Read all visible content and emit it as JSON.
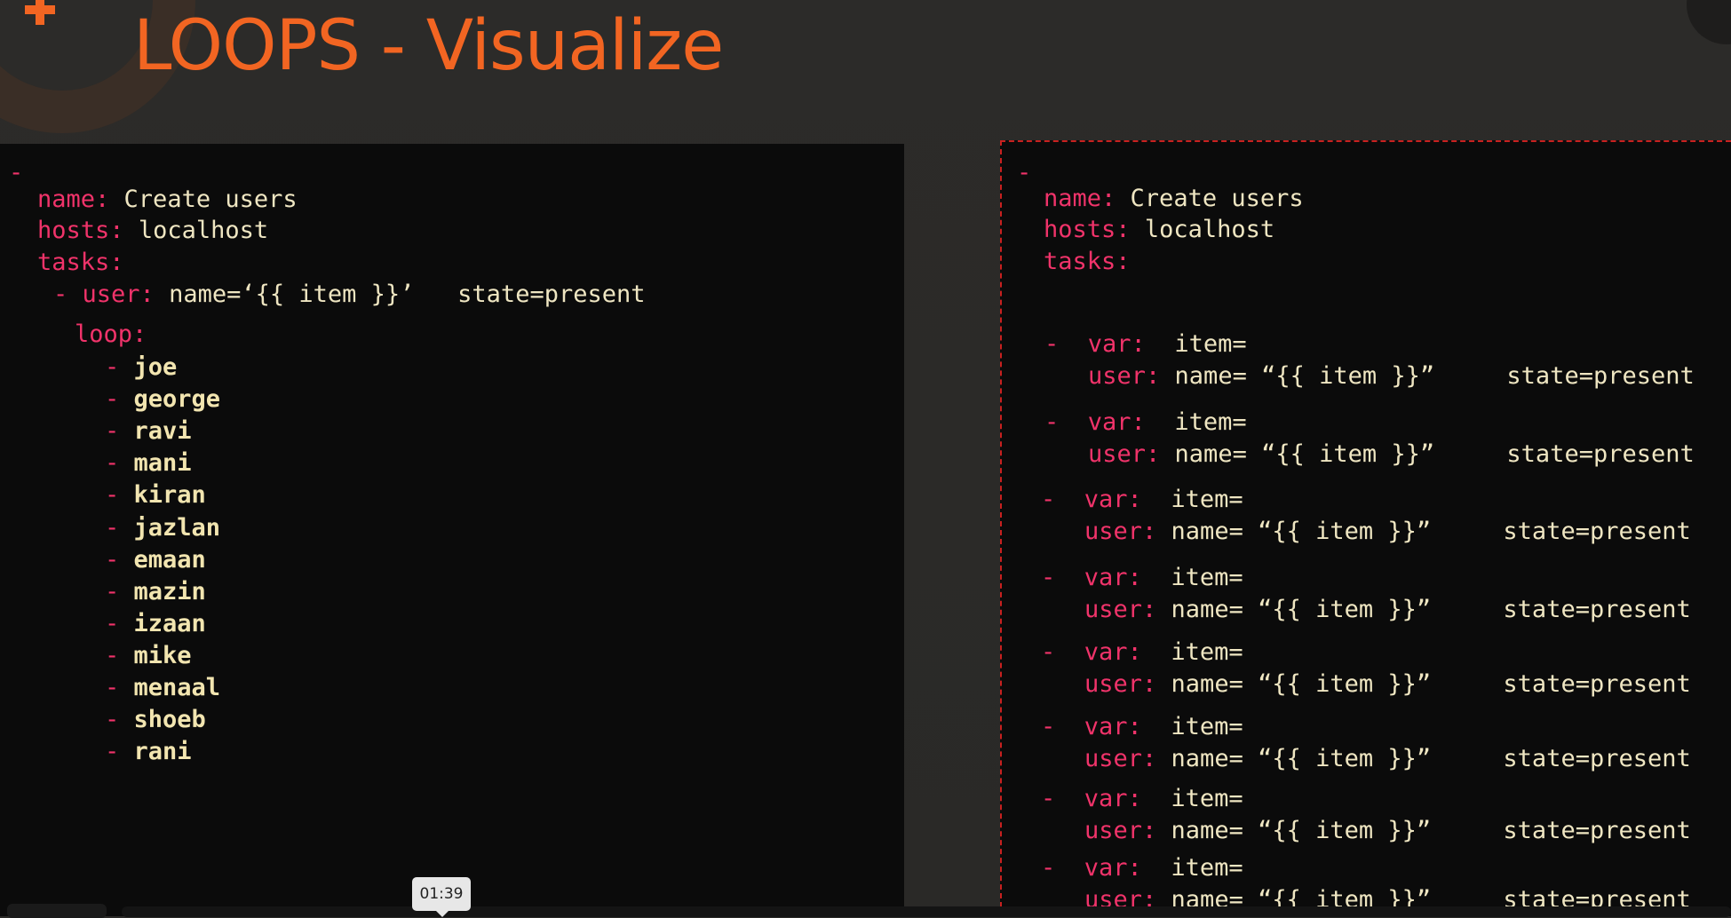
{
  "slide": {
    "title": "LOOPS - Visualize"
  },
  "left_panel": {
    "dash": "-",
    "name_key": "name:",
    "name_val": "Create users",
    "hosts_key": "hosts:",
    "hosts_val": "localhost",
    "tasks_key": "tasks:",
    "task_dash": "- ",
    "task_key": "user:",
    "task_val": "name=‘{{ item }}’   state=present",
    "loop_key": "loop:",
    "item_dash": "-",
    "items": [
      "joe",
      "george",
      "ravi",
      "mani",
      "kiran",
      "jazlan",
      "emaan",
      "mazin",
      "izaan",
      "mike",
      "menaal",
      "shoeb",
      "rani"
    ]
  },
  "right_panel": {
    "dash": "-",
    "name_key": "name:",
    "name_val": "Create users",
    "hosts_key": "hosts:",
    "hosts_val": "localhost",
    "tasks_key": "tasks:",
    "entry": {
      "dash": "-",
      "var_key": "var:",
      "var_val": "item=",
      "user_key": "user:",
      "user_val": "name= “{{ item }}”     state=present"
    },
    "entry_count": 8
  },
  "player": {
    "time": "01:39"
  },
  "colors": {
    "title": "#f26522",
    "key": "#f0336a",
    "value": "#efe6c2",
    "panel": "#0b0b0b",
    "dashed_border": "#c8201f"
  }
}
